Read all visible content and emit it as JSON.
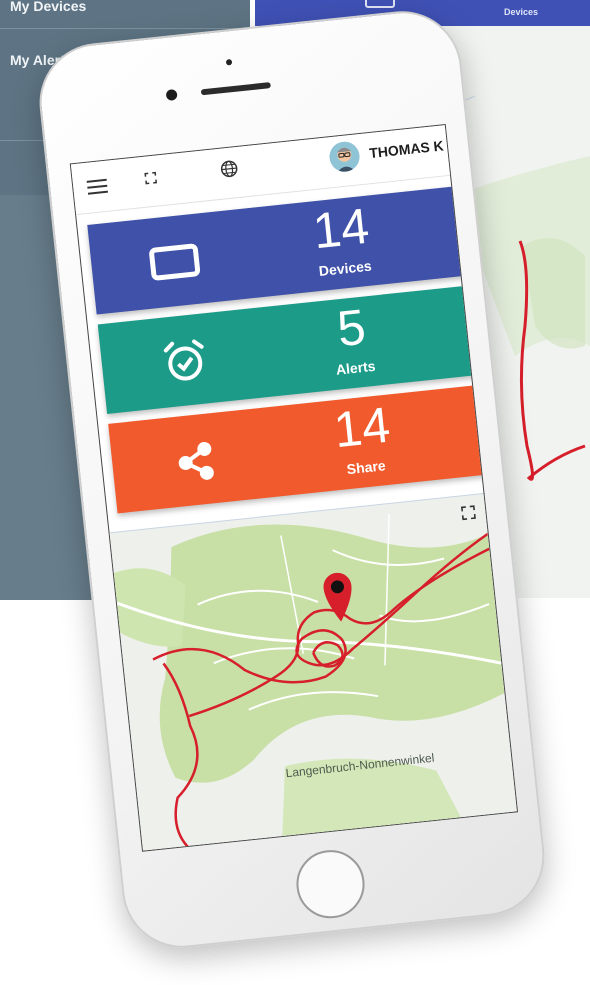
{
  "background_app": {
    "sidebar": {
      "items": [
        {
          "label": "My Devices"
        },
        {
          "label": "My Alerts"
        }
      ]
    },
    "topbar": {
      "devices_label": "Devices",
      "color": "#3f51b5"
    }
  },
  "app": {
    "header": {
      "menu_icon": "hamburger-icon",
      "expand_icon": "expand-icon",
      "language_icon": "globe-icon",
      "user_name": "THOMAS K"
    },
    "cards": [
      {
        "id": "devices",
        "value": "14",
        "label": "Devices",
        "icon": "tablet-icon",
        "color": "#3f51a8"
      },
      {
        "id": "alerts",
        "value": "5",
        "label": "Alerts",
        "icon": "alarm-clock-icon",
        "color": "#1b9b88"
      },
      {
        "id": "share",
        "value": "14",
        "label": "Share",
        "icon": "share-icon",
        "color": "#f05a2c"
      }
    ],
    "map": {
      "place_label": "Langenbruch-Nonnenwinkel",
      "fullscreen_icon": "fullscreen-icon",
      "marker_icon": "map-pin-icon",
      "track_color": "#d61f2b"
    }
  }
}
